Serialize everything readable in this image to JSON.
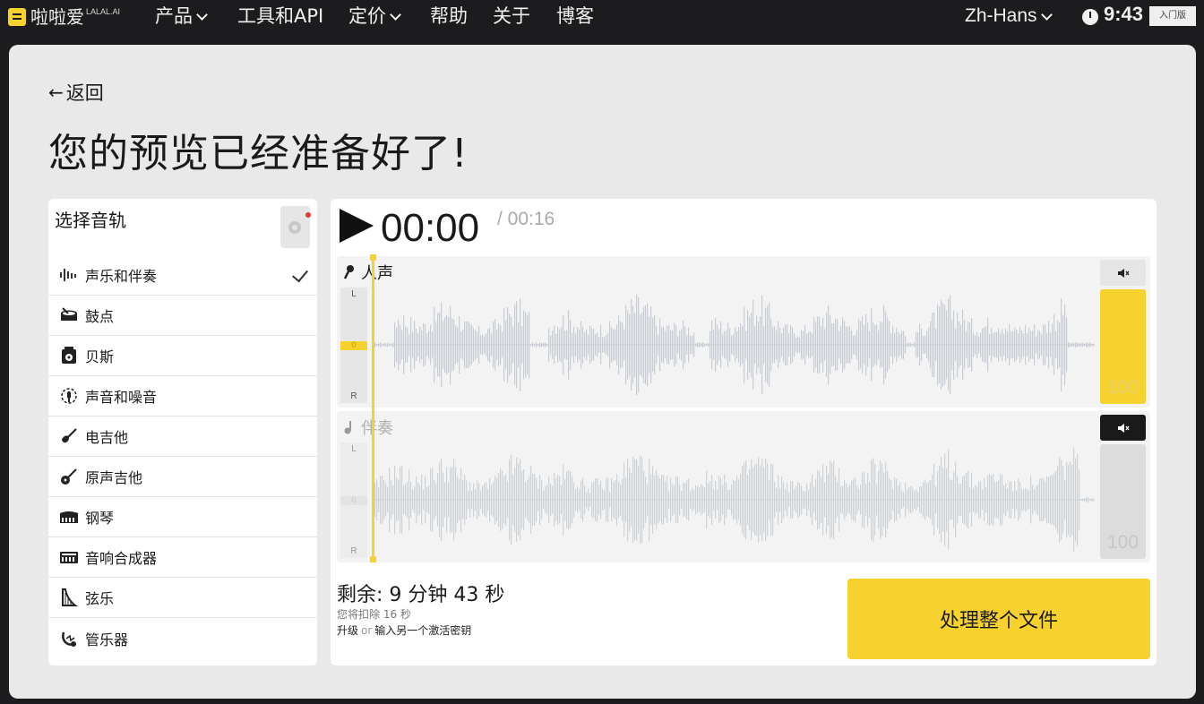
{
  "nav": {
    "logo_text": "啦啦爱",
    "logo_sup": "LALAL.AI",
    "items": [
      {
        "label": "产品",
        "dropdown": true
      },
      {
        "label": "工具和API",
        "dropdown": false
      },
      {
        "label": "定价",
        "dropdown": true
      },
      {
        "label": "帮助",
        "dropdown": false
      },
      {
        "label": "关于",
        "dropdown": false
      },
      {
        "label": "博客",
        "dropdown": false
      }
    ],
    "language": "Zh-Hans",
    "time": "9:43",
    "plan": "入门版"
  },
  "page": {
    "back_label": "返回",
    "title": "您的预览已经准备好了!"
  },
  "sidebar": {
    "title": "选择音轨",
    "tracks": [
      {
        "label": "声乐和伴奏",
        "icon": "waveform-icon",
        "selected": true
      },
      {
        "label": "鼓点",
        "icon": "drum-icon",
        "selected": false
      },
      {
        "label": "贝斯",
        "icon": "bass-amp-icon",
        "selected": false
      },
      {
        "label": "声音和噪音",
        "icon": "voice-noise-icon",
        "selected": false
      },
      {
        "label": "电吉他",
        "icon": "electric-guitar-icon",
        "selected": false
      },
      {
        "label": "原声吉他",
        "icon": "acoustic-guitar-icon",
        "selected": false
      },
      {
        "label": "钢琴",
        "icon": "piano-icon",
        "selected": false
      },
      {
        "label": "音响合成器",
        "icon": "synthesizer-icon",
        "selected": false
      },
      {
        "label": "弦乐",
        "icon": "strings-icon",
        "selected": false
      },
      {
        "label": "管乐器",
        "icon": "wind-instrument-icon",
        "selected": false
      }
    ]
  },
  "player": {
    "current_time": "00:00",
    "total_time": "/ 00:16",
    "lanes": [
      {
        "label": "人声",
        "pan_l": "L",
        "pan_c": "0",
        "pan_r": "R",
        "volume": "100",
        "muted": false
      },
      {
        "label": "伴奏",
        "pan_l": "L",
        "pan_c": "0",
        "pan_r": "R",
        "volume": "100",
        "muted": true
      }
    ]
  },
  "footer": {
    "remaining": "剩余: 9 分钟 43 秒",
    "deduct": "您将扣除 16 秒",
    "upgrade": "升级",
    "or": "or",
    "activation": "输入另一个激活密钥",
    "process_button": "处理整个文件"
  },
  "colors": {
    "accent": "#f6d22f",
    "nav_bg": "#1c1b1d",
    "panel_bg": "#e9e9e9",
    "wave": "#c9cdd1"
  }
}
